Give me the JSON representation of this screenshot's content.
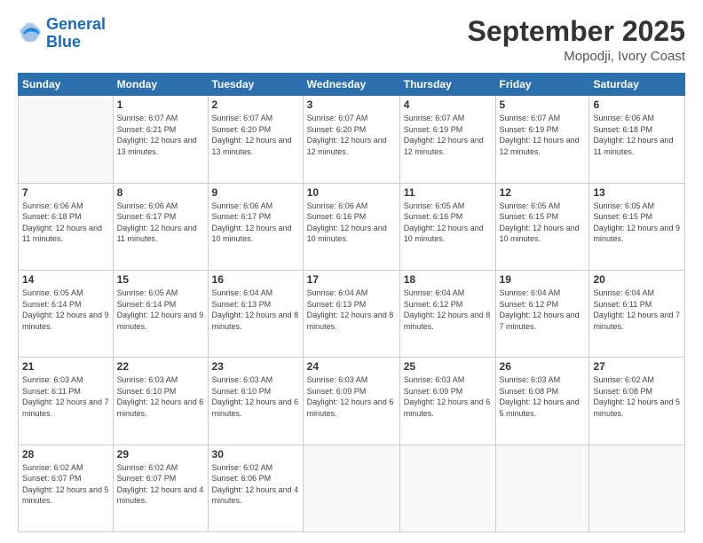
{
  "logo": {
    "line1": "General",
    "line2": "Blue"
  },
  "title": "September 2025",
  "location": "Mopodji, Ivory Coast",
  "days_of_week": [
    "Sunday",
    "Monday",
    "Tuesday",
    "Wednesday",
    "Thursday",
    "Friday",
    "Saturday"
  ],
  "weeks": [
    [
      {
        "day": "",
        "sunrise": "",
        "sunset": "",
        "daylight": ""
      },
      {
        "day": "1",
        "sunrise": "Sunrise: 6:07 AM",
        "sunset": "Sunset: 6:21 PM",
        "daylight": "Daylight: 12 hours and 13 minutes."
      },
      {
        "day": "2",
        "sunrise": "Sunrise: 6:07 AM",
        "sunset": "Sunset: 6:20 PM",
        "daylight": "Daylight: 12 hours and 13 minutes."
      },
      {
        "day": "3",
        "sunrise": "Sunrise: 6:07 AM",
        "sunset": "Sunset: 6:20 PM",
        "daylight": "Daylight: 12 hours and 12 minutes."
      },
      {
        "day": "4",
        "sunrise": "Sunrise: 6:07 AM",
        "sunset": "Sunset: 6:19 PM",
        "daylight": "Daylight: 12 hours and 12 minutes."
      },
      {
        "day": "5",
        "sunrise": "Sunrise: 6:07 AM",
        "sunset": "Sunset: 6:19 PM",
        "daylight": "Daylight: 12 hours and 12 minutes."
      },
      {
        "day": "6",
        "sunrise": "Sunrise: 6:06 AM",
        "sunset": "Sunset: 6:18 PM",
        "daylight": "Daylight: 12 hours and 11 minutes."
      }
    ],
    [
      {
        "day": "7",
        "sunrise": "Sunrise: 6:06 AM",
        "sunset": "Sunset: 6:18 PM",
        "daylight": "Daylight: 12 hours and 11 minutes."
      },
      {
        "day": "8",
        "sunrise": "Sunrise: 6:06 AM",
        "sunset": "Sunset: 6:17 PM",
        "daylight": "Daylight: 12 hours and 11 minutes."
      },
      {
        "day": "9",
        "sunrise": "Sunrise: 6:06 AM",
        "sunset": "Sunset: 6:17 PM",
        "daylight": "Daylight: 12 hours and 10 minutes."
      },
      {
        "day": "10",
        "sunrise": "Sunrise: 6:06 AM",
        "sunset": "Sunset: 6:16 PM",
        "daylight": "Daylight: 12 hours and 10 minutes."
      },
      {
        "day": "11",
        "sunrise": "Sunrise: 6:05 AM",
        "sunset": "Sunset: 6:16 PM",
        "daylight": "Daylight: 12 hours and 10 minutes."
      },
      {
        "day": "12",
        "sunrise": "Sunrise: 6:05 AM",
        "sunset": "Sunset: 6:15 PM",
        "daylight": "Daylight: 12 hours and 10 minutes."
      },
      {
        "day": "13",
        "sunrise": "Sunrise: 6:05 AM",
        "sunset": "Sunset: 6:15 PM",
        "daylight": "Daylight: 12 hours and 9 minutes."
      }
    ],
    [
      {
        "day": "14",
        "sunrise": "Sunrise: 6:05 AM",
        "sunset": "Sunset: 6:14 PM",
        "daylight": "Daylight: 12 hours and 9 minutes."
      },
      {
        "day": "15",
        "sunrise": "Sunrise: 6:05 AM",
        "sunset": "Sunset: 6:14 PM",
        "daylight": "Daylight: 12 hours and 9 minutes."
      },
      {
        "day": "16",
        "sunrise": "Sunrise: 6:04 AM",
        "sunset": "Sunset: 6:13 PM",
        "daylight": "Daylight: 12 hours and 8 minutes."
      },
      {
        "day": "17",
        "sunrise": "Sunrise: 6:04 AM",
        "sunset": "Sunset: 6:13 PM",
        "daylight": "Daylight: 12 hours and 8 minutes."
      },
      {
        "day": "18",
        "sunrise": "Sunrise: 6:04 AM",
        "sunset": "Sunset: 6:12 PM",
        "daylight": "Daylight: 12 hours and 8 minutes."
      },
      {
        "day": "19",
        "sunrise": "Sunrise: 6:04 AM",
        "sunset": "Sunset: 6:12 PM",
        "daylight": "Daylight: 12 hours and 7 minutes."
      },
      {
        "day": "20",
        "sunrise": "Sunrise: 6:04 AM",
        "sunset": "Sunset: 6:11 PM",
        "daylight": "Daylight: 12 hours and 7 minutes."
      }
    ],
    [
      {
        "day": "21",
        "sunrise": "Sunrise: 6:03 AM",
        "sunset": "Sunset: 6:11 PM",
        "daylight": "Daylight: 12 hours and 7 minutes."
      },
      {
        "day": "22",
        "sunrise": "Sunrise: 6:03 AM",
        "sunset": "Sunset: 6:10 PM",
        "daylight": "Daylight: 12 hours and 6 minutes."
      },
      {
        "day": "23",
        "sunrise": "Sunrise: 6:03 AM",
        "sunset": "Sunset: 6:10 PM",
        "daylight": "Daylight: 12 hours and 6 minutes."
      },
      {
        "day": "24",
        "sunrise": "Sunrise: 6:03 AM",
        "sunset": "Sunset: 6:09 PM",
        "daylight": "Daylight: 12 hours and 6 minutes."
      },
      {
        "day": "25",
        "sunrise": "Sunrise: 6:03 AM",
        "sunset": "Sunset: 6:09 PM",
        "daylight": "Daylight: 12 hours and 6 minutes."
      },
      {
        "day": "26",
        "sunrise": "Sunrise: 6:03 AM",
        "sunset": "Sunset: 6:08 PM",
        "daylight": "Daylight: 12 hours and 5 minutes."
      },
      {
        "day": "27",
        "sunrise": "Sunrise: 6:02 AM",
        "sunset": "Sunset: 6:08 PM",
        "daylight": "Daylight: 12 hours and 5 minutes."
      }
    ],
    [
      {
        "day": "28",
        "sunrise": "Sunrise: 6:02 AM",
        "sunset": "Sunset: 6:07 PM",
        "daylight": "Daylight: 12 hours and 5 minutes."
      },
      {
        "day": "29",
        "sunrise": "Sunrise: 6:02 AM",
        "sunset": "Sunset: 6:07 PM",
        "daylight": "Daylight: 12 hours and 4 minutes."
      },
      {
        "day": "30",
        "sunrise": "Sunrise: 6:02 AM",
        "sunset": "Sunset: 6:06 PM",
        "daylight": "Daylight: 12 hours and 4 minutes."
      },
      {
        "day": "",
        "sunrise": "",
        "sunset": "",
        "daylight": ""
      },
      {
        "day": "",
        "sunrise": "",
        "sunset": "",
        "daylight": ""
      },
      {
        "day": "",
        "sunrise": "",
        "sunset": "",
        "daylight": ""
      },
      {
        "day": "",
        "sunrise": "",
        "sunset": "",
        "daylight": ""
      }
    ]
  ]
}
